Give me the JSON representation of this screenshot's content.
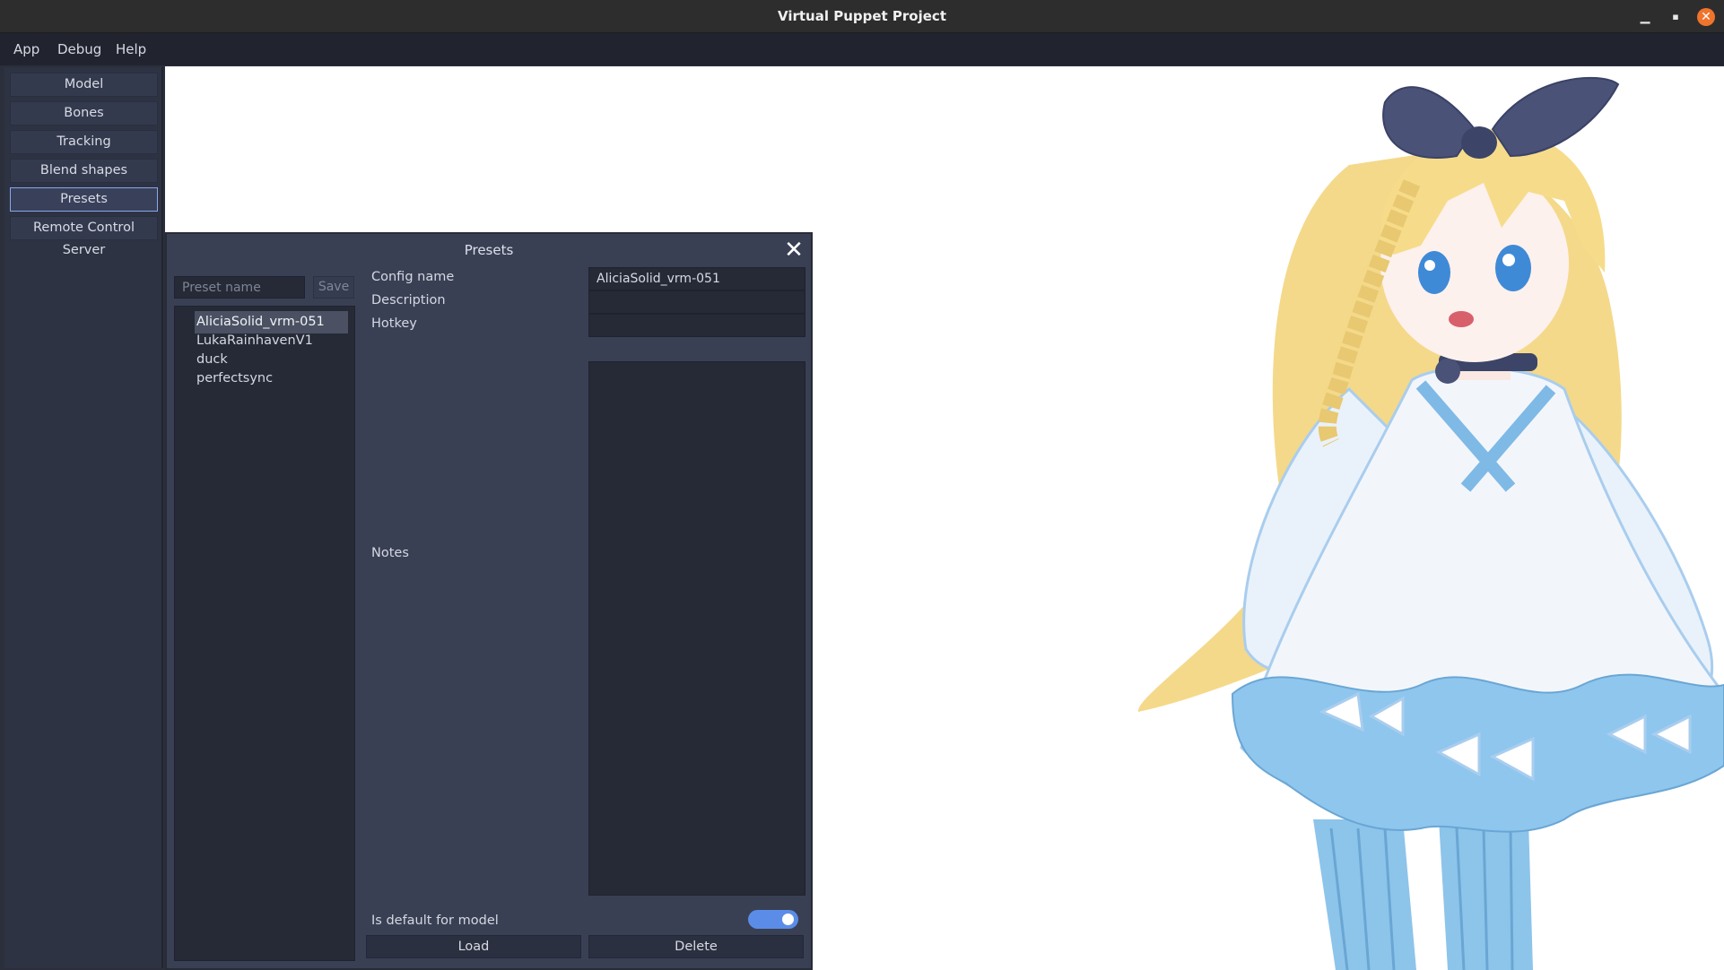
{
  "window": {
    "title": "Virtual Puppet Project",
    "minimize_glyph": "▁",
    "maximize_glyph": "▪",
    "close_glyph": "✕"
  },
  "menubar": {
    "items": [
      "App",
      "Debug",
      "Help"
    ]
  },
  "sidebar": {
    "items": [
      {
        "label": "Model",
        "active": false
      },
      {
        "label": "Bones",
        "active": false
      },
      {
        "label": "Tracking",
        "active": false
      },
      {
        "label": "Blend shapes",
        "active": false
      },
      {
        "label": "Presets",
        "active": true
      },
      {
        "label": "Remote Control Server",
        "active": false
      }
    ]
  },
  "presets_dialog": {
    "title": "Presets",
    "close_glyph": "✕",
    "preset_name_placeholder": "Preset name",
    "save_label": "Save",
    "list": [
      {
        "name": "AliciaSolid_vrm-051",
        "selected": true
      },
      {
        "name": "LukaRainhavenV1",
        "selected": false
      },
      {
        "name": "duck",
        "selected": false
      },
      {
        "name": "perfectsync",
        "selected": false
      }
    ],
    "fields": {
      "config_name_label": "Config name",
      "config_name_value": "AliciaSolid_vrm-051",
      "description_label": "Description",
      "description_value": "",
      "hotkey_label": "Hotkey",
      "hotkey_value": "",
      "notes_label": "Notes",
      "notes_value": ""
    },
    "is_default_label": "Is default for model",
    "is_default_value": true,
    "load_label": "Load",
    "delete_label": "Delete"
  },
  "colors": {
    "accent": "#5b8de8",
    "close_button": "#f0742c",
    "panel_bg": "#3a4054",
    "hair": "#f6dc8a",
    "dress": "#8ec6ee",
    "ribbon": "#4a5277"
  }
}
